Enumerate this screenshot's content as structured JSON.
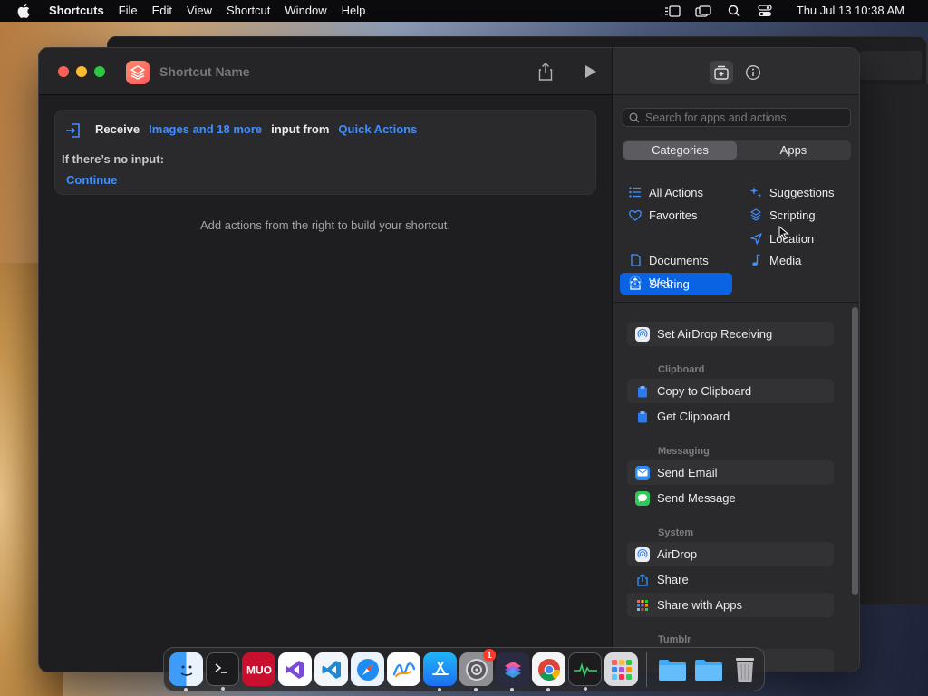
{
  "menubar": {
    "app_name": "Shortcuts",
    "items": [
      "File",
      "Edit",
      "View",
      "Shortcut",
      "Window",
      "Help"
    ],
    "clock": "Thu Jul 13  10:38 AM"
  },
  "editor": {
    "shortcut_name": "Shortcut Name",
    "receive": {
      "label": "Receive",
      "types": "Images and 18 more",
      "input_from": "input from",
      "source": "Quick Actions",
      "no_input_label": "If there’s no input:",
      "no_input_action": "Continue"
    },
    "hint": "Add actions from the right to build your shortcut."
  },
  "panel": {
    "search_placeholder": "Search for apps and actions",
    "segments": [
      "Categories",
      "Apps"
    ],
    "categories": [
      {
        "label": "All Actions",
        "icon": "list-icon",
        "selected": false
      },
      {
        "label": "Favorites",
        "icon": "heart-icon",
        "selected": false
      },
      {
        "label": "Sharing",
        "icon": "share-icon",
        "selected": true
      },
      {
        "label": "Documents",
        "icon": "document-icon",
        "selected": false
      },
      {
        "label": "Web",
        "icon": "compass-icon",
        "selected": false
      },
      {
        "label": "Suggestions",
        "icon": "sparkles-icon",
        "selected": false
      },
      {
        "label": "Scripting",
        "icon": "scripting-icon",
        "selected": false
      },
      {
        "label": "Location",
        "icon": "location-arrow-icon",
        "selected": false
      },
      {
        "label": "Media",
        "icon": "music-note-icon",
        "selected": false
      }
    ],
    "actions": {
      "top": "Set AirDrop Receiving",
      "clipboard_header": "Clipboard",
      "copy_clipboard": "Copy to Clipboard",
      "get_clipboard": "Get Clipboard",
      "messaging_header": "Messaging",
      "send_email": "Send Email",
      "send_message": "Send Message",
      "system_header": "System",
      "airdrop": "AirDrop",
      "share": "Share",
      "share_with_apps": "Share with Apps",
      "tumblr_header": "Tumblr"
    }
  },
  "dock": {
    "apps": [
      "Finder",
      "Terminal",
      "MUO",
      "Visual Studio",
      "VS Code",
      "Safari",
      "Freeform",
      "App Store",
      "System Settings",
      "Shortcuts",
      "Chrome",
      "Activity Monitor",
      "Launchpad",
      "Folder",
      "Folder",
      "Trash"
    ],
    "settings_badge": "1"
  },
  "colors": {
    "accent": "#0a63e3",
    "link": "#3f8fff",
    "shortcuts_icon": "#ff6b5f"
  }
}
